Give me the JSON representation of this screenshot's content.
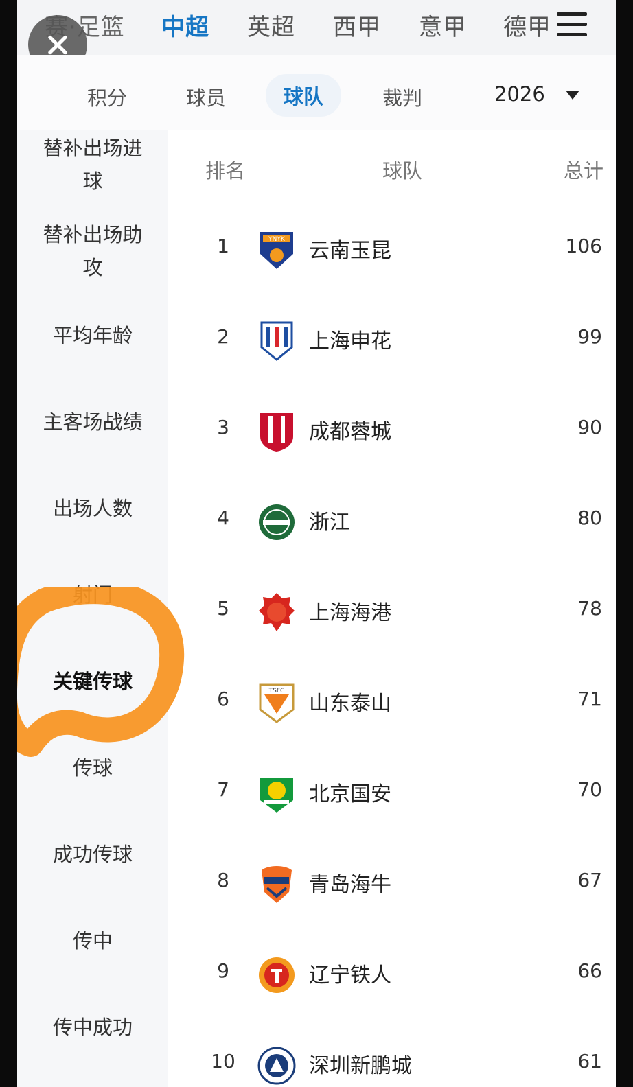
{
  "league_tabs": [
    "赛·足篮",
    "中超",
    "英超",
    "西甲",
    "意甲",
    "德甲"
  ],
  "active_league": "中超",
  "sub_tabs": [
    "积分",
    "球员",
    "球队",
    "裁判"
  ],
  "active_sub_tab": "球队",
  "season": "2026",
  "sidebar": {
    "items": [
      {
        "label": "替补出场进\n球"
      },
      {
        "label": "替补出场助\n攻"
      },
      {
        "label": "平均年龄"
      },
      {
        "label": "主客场战绩"
      },
      {
        "label": "出场人数"
      },
      {
        "label": "射门"
      },
      {
        "label": "关键传球"
      },
      {
        "label": "传球"
      },
      {
        "label": "成功传球"
      },
      {
        "label": "传中"
      },
      {
        "label": "传中成功"
      }
    ],
    "active": "关键传球"
  },
  "table": {
    "headers": {
      "rank": "排名",
      "team": "球队",
      "total": "总计"
    },
    "rows": [
      {
        "rank": "1",
        "team": "云南玉昆",
        "total": "106",
        "logo": "yunnan-yukun-logo"
      },
      {
        "rank": "2",
        "team": "上海申花",
        "total": "99",
        "logo": "shanghai-shenhua-logo"
      },
      {
        "rank": "3",
        "team": "成都蓉城",
        "total": "90",
        "logo": "chengdu-rongcheng-logo"
      },
      {
        "rank": "4",
        "team": "浙江",
        "total": "80",
        "logo": "zhejiang-logo"
      },
      {
        "rank": "5",
        "team": "上海海港",
        "total": "78",
        "logo": "shanghai-port-logo"
      },
      {
        "rank": "6",
        "team": "山东泰山",
        "total": "71",
        "logo": "shandong-taishan-logo"
      },
      {
        "rank": "7",
        "team": "北京国安",
        "total": "70",
        "logo": "beijing-guoan-logo"
      },
      {
        "rank": "8",
        "team": "青岛海牛",
        "total": "67",
        "logo": "qingdao-hainiu-logo"
      },
      {
        "rank": "9",
        "team": "辽宁铁人",
        "total": "66",
        "logo": "liaoning-tieren-logo"
      },
      {
        "rank": "10",
        "team": "深圳新鹏城",
        "total": "61",
        "logo": "shenzhen-xinpengcheng-logo"
      }
    ]
  },
  "colors": {
    "accent": "#1676c4",
    "annotation": "#f7931e"
  }
}
